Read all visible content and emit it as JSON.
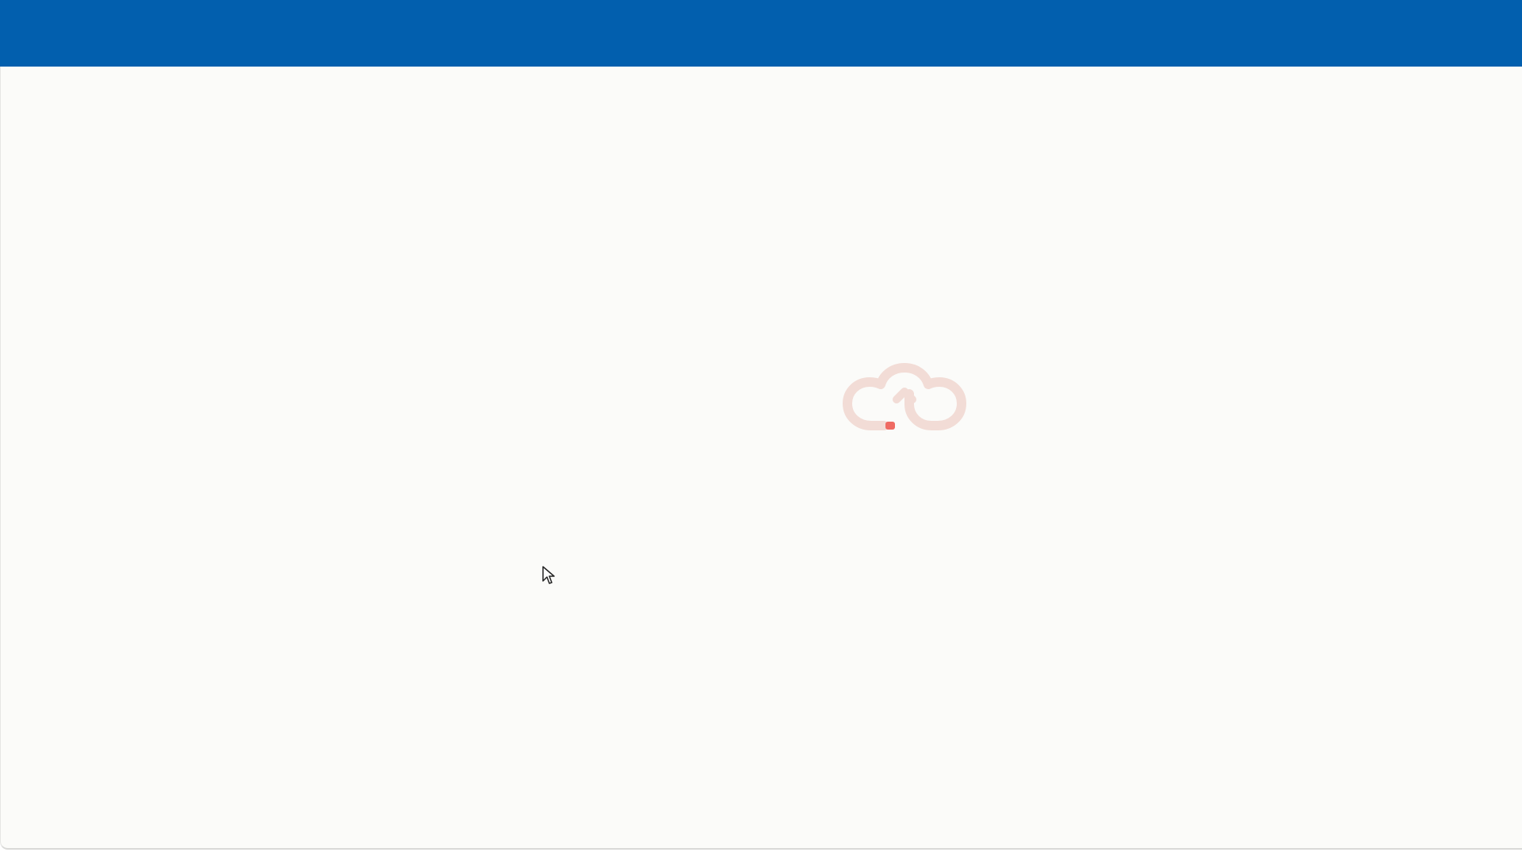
{
  "header": {
    "background_color": "#025fae"
  },
  "main": {
    "background_color": "#fbfbf9",
    "loader": {
      "icon": "cloud-upload-icon",
      "state": "loading",
      "outline_color": "#f2dcd6",
      "progress_dot_color": "#ef6b63"
    }
  },
  "pointer": {
    "icon": "mouse-pointer-icon"
  }
}
